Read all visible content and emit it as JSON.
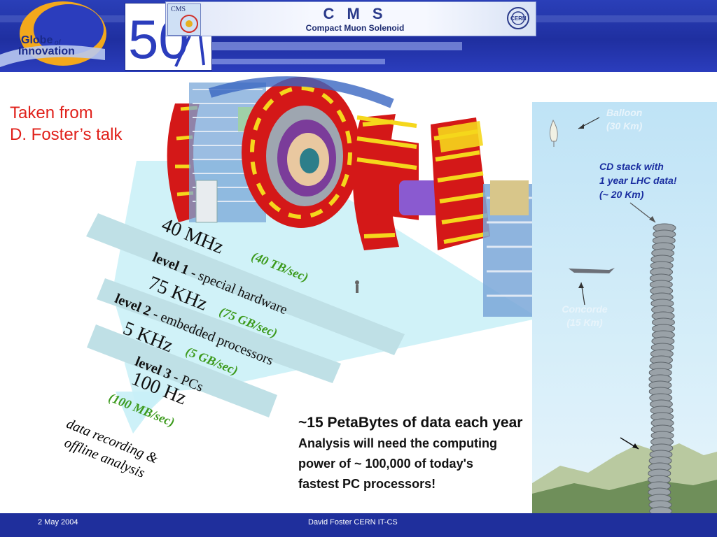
{
  "header": {
    "globe_logo_line1": "Globe",
    "globe_logo_of": "of",
    "globe_logo_line2": "Innovation",
    "anniversary_number": "50",
    "cms_small": "CMS",
    "cms_title": "C M S",
    "cms_subtitle": "Compact Muon Solenoid",
    "cern_label": "CERN",
    "accent_color": "#1f2f9c"
  },
  "credit": {
    "line1": "Taken from",
    "line2": "D. Foster’s talk",
    "color": "#e0201a"
  },
  "trigger": {
    "rate1": "40 MHz",
    "rate1_bw": "(40 TB/sec)",
    "level1_name": "level 1 -",
    "level1_desc": "special hardware",
    "rate2": "75 KHz",
    "rate2_bw": "(75 GB/sec)",
    "level2_name": "level 2 -",
    "level2_desc": "embedded processors",
    "rate3": "5 KHz",
    "rate3_bw": "(5 GB/sec)",
    "level3_name": "level 3 -",
    "level3_desc": "PCs",
    "rate4": "100 Hz",
    "rate4_bw": "(100 MB/sec)",
    "output_line1": "data recording &",
    "output_line2": "offline analysis",
    "bandwidth_color": "#3c9a1c"
  },
  "comparison": {
    "balloon_line1": "Balloon",
    "balloon_line2": "(30 Km)",
    "cd_line1": "CD stack with",
    "cd_line2": "1 year LHC data!",
    "cd_line3": "(~ 20 Km)",
    "concorde_line1": "Concorde",
    "concorde_line2": "(15 Km)"
  },
  "summary": {
    "title": "~15 PetaBytes of data each year",
    "line1": "Analysis will need the computing",
    "line2": "power of ~ 100,000 of today's",
    "line3": "fastest PC processors!"
  },
  "footer": {
    "date": "2 May 2004",
    "author": "David Foster CERN IT-CS"
  }
}
